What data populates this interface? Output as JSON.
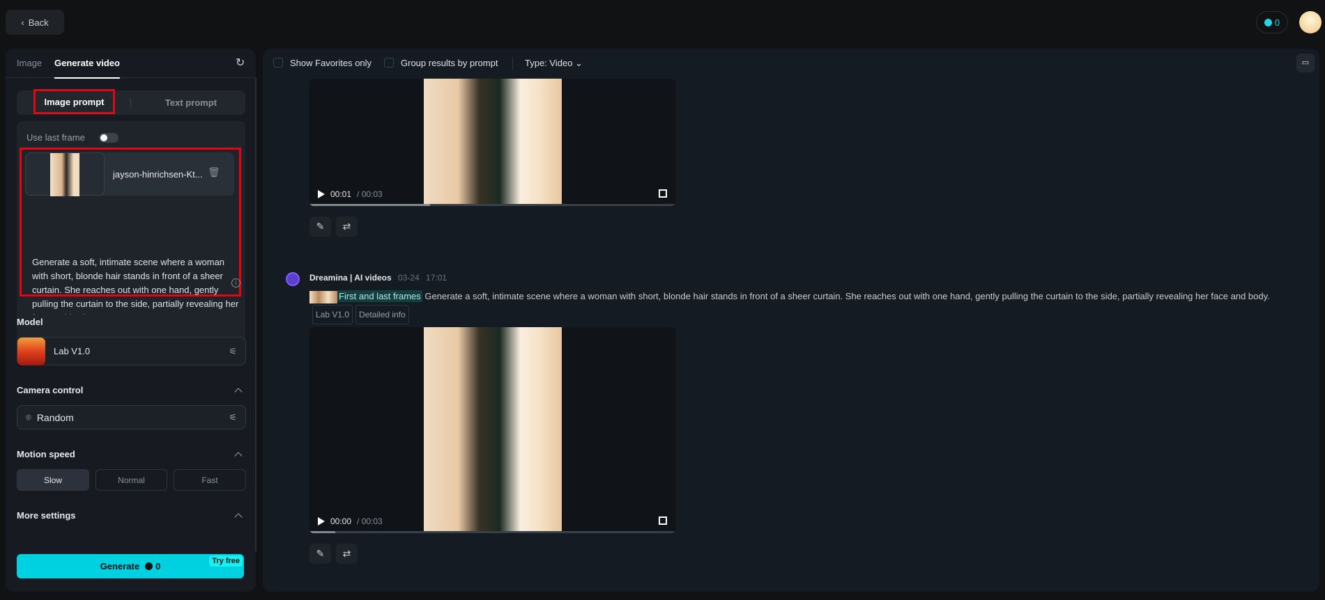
{
  "header": {
    "back_label": "Back",
    "credits": "0"
  },
  "left": {
    "tabs": [
      "Image",
      "Generate video"
    ],
    "prompt_modes": [
      "Image prompt",
      "Text prompt"
    ],
    "use_last_frame_label": "Use last frame",
    "use_last_frame_on": false,
    "image_file": "jayson-hinrichsen-Kt...",
    "prompt_text": "Generate a soft, intimate scene where a woman with short, blonde hair stands in front of a sheer curtain. She reaches out with one hand, gently pulling the curtain to the side, partially revealing her face and body.",
    "model_label": "Model",
    "model_value": "Lab V1.0",
    "camera_label": "Camera control",
    "camera_value": "Random",
    "motion_label": "Motion speed",
    "motion_options": [
      "Slow",
      "Normal",
      "Fast"
    ],
    "motion_selected": "Slow",
    "more_label": "More settings",
    "generate_label": "Generate",
    "generate_cost": "0",
    "try_free": "Try free"
  },
  "toolbar": {
    "favorites_label": "Show Favorites only",
    "group_label": "Group results by prompt",
    "type_label": "Type: Video"
  },
  "results": [
    {
      "current": "00:01",
      "duration": "/ 00:03",
      "progress": 0.33
    },
    {
      "author": "Dreamina | AI videos",
      "date": "03-24",
      "time": "17:01",
      "mode_tag": "First and last frames",
      "prompt": "Generate a soft, intimate scene where a woman with short, blonde hair stands in front of a sheer curtain. She reaches out with one hand, gently pulling the curtain to the side, partially revealing her face and body.",
      "model_tag": "Lab V1.0",
      "info_tag": "Detailed info",
      "current": "00:00",
      "duration": "/ 00:03",
      "progress": 0.07
    }
  ],
  "colors": {
    "accent": "#00d1e0",
    "highlight": "#e30613"
  }
}
